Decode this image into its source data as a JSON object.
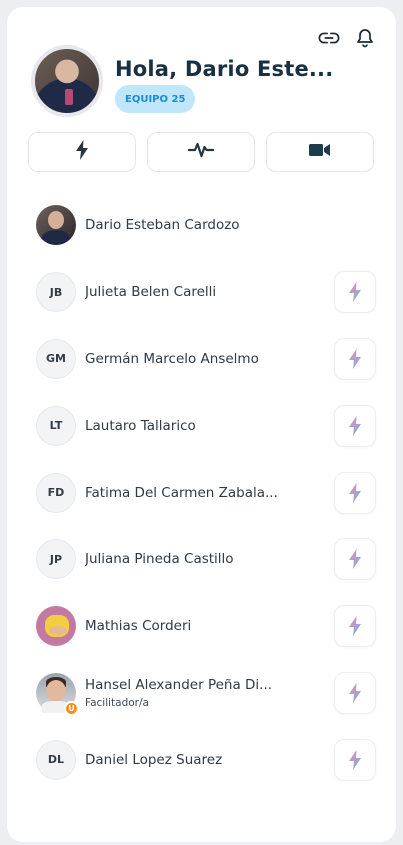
{
  "header": {
    "greeting": "Hola, Dario Este...",
    "team_badge": "EQUIPO 25",
    "icons": [
      "link-icon",
      "bell-icon"
    ]
  },
  "actions": [
    {
      "icon": "bolt-icon"
    },
    {
      "icon": "activity-pulse-icon"
    },
    {
      "icon": "video-camera-icon"
    }
  ],
  "members": [
    {
      "name": "Dario Esteban Cardozo",
      "initials": "",
      "avatar": "photo",
      "role": ""
    },
    {
      "name": "Julieta Belen Carelli",
      "initials": "JB",
      "role": ""
    },
    {
      "name": "Germán Marcelo Anselmo",
      "initials": "GM",
      "role": ""
    },
    {
      "name": "Lautaro Tallarico",
      "initials": "LT",
      "role": ""
    },
    {
      "name": "Fatima Del Carmen Zabala...",
      "initials": "FD",
      "role": ""
    },
    {
      "name": "Juliana Pineda Castillo",
      "initials": "JP",
      "role": ""
    },
    {
      "name": "Mathias Corderi",
      "initials": "",
      "avatar": "photo",
      "role": ""
    },
    {
      "name": "Hansel Alexander Peña Di...",
      "initials": "",
      "avatar": "photo",
      "role": "Facilitador/a",
      "badge": "U"
    },
    {
      "name": "Daniel Lopez Suarez",
      "initials": "DL",
      "role": ""
    }
  ],
  "colors": {
    "title": "#173042",
    "badge_bg": "#bfe6fb",
    "badge_text": "#1b8cd4",
    "bolt_gradient": [
      "#f08ab2",
      "#6fb6ea"
    ],
    "facilitator_badge": "#f5901e"
  }
}
